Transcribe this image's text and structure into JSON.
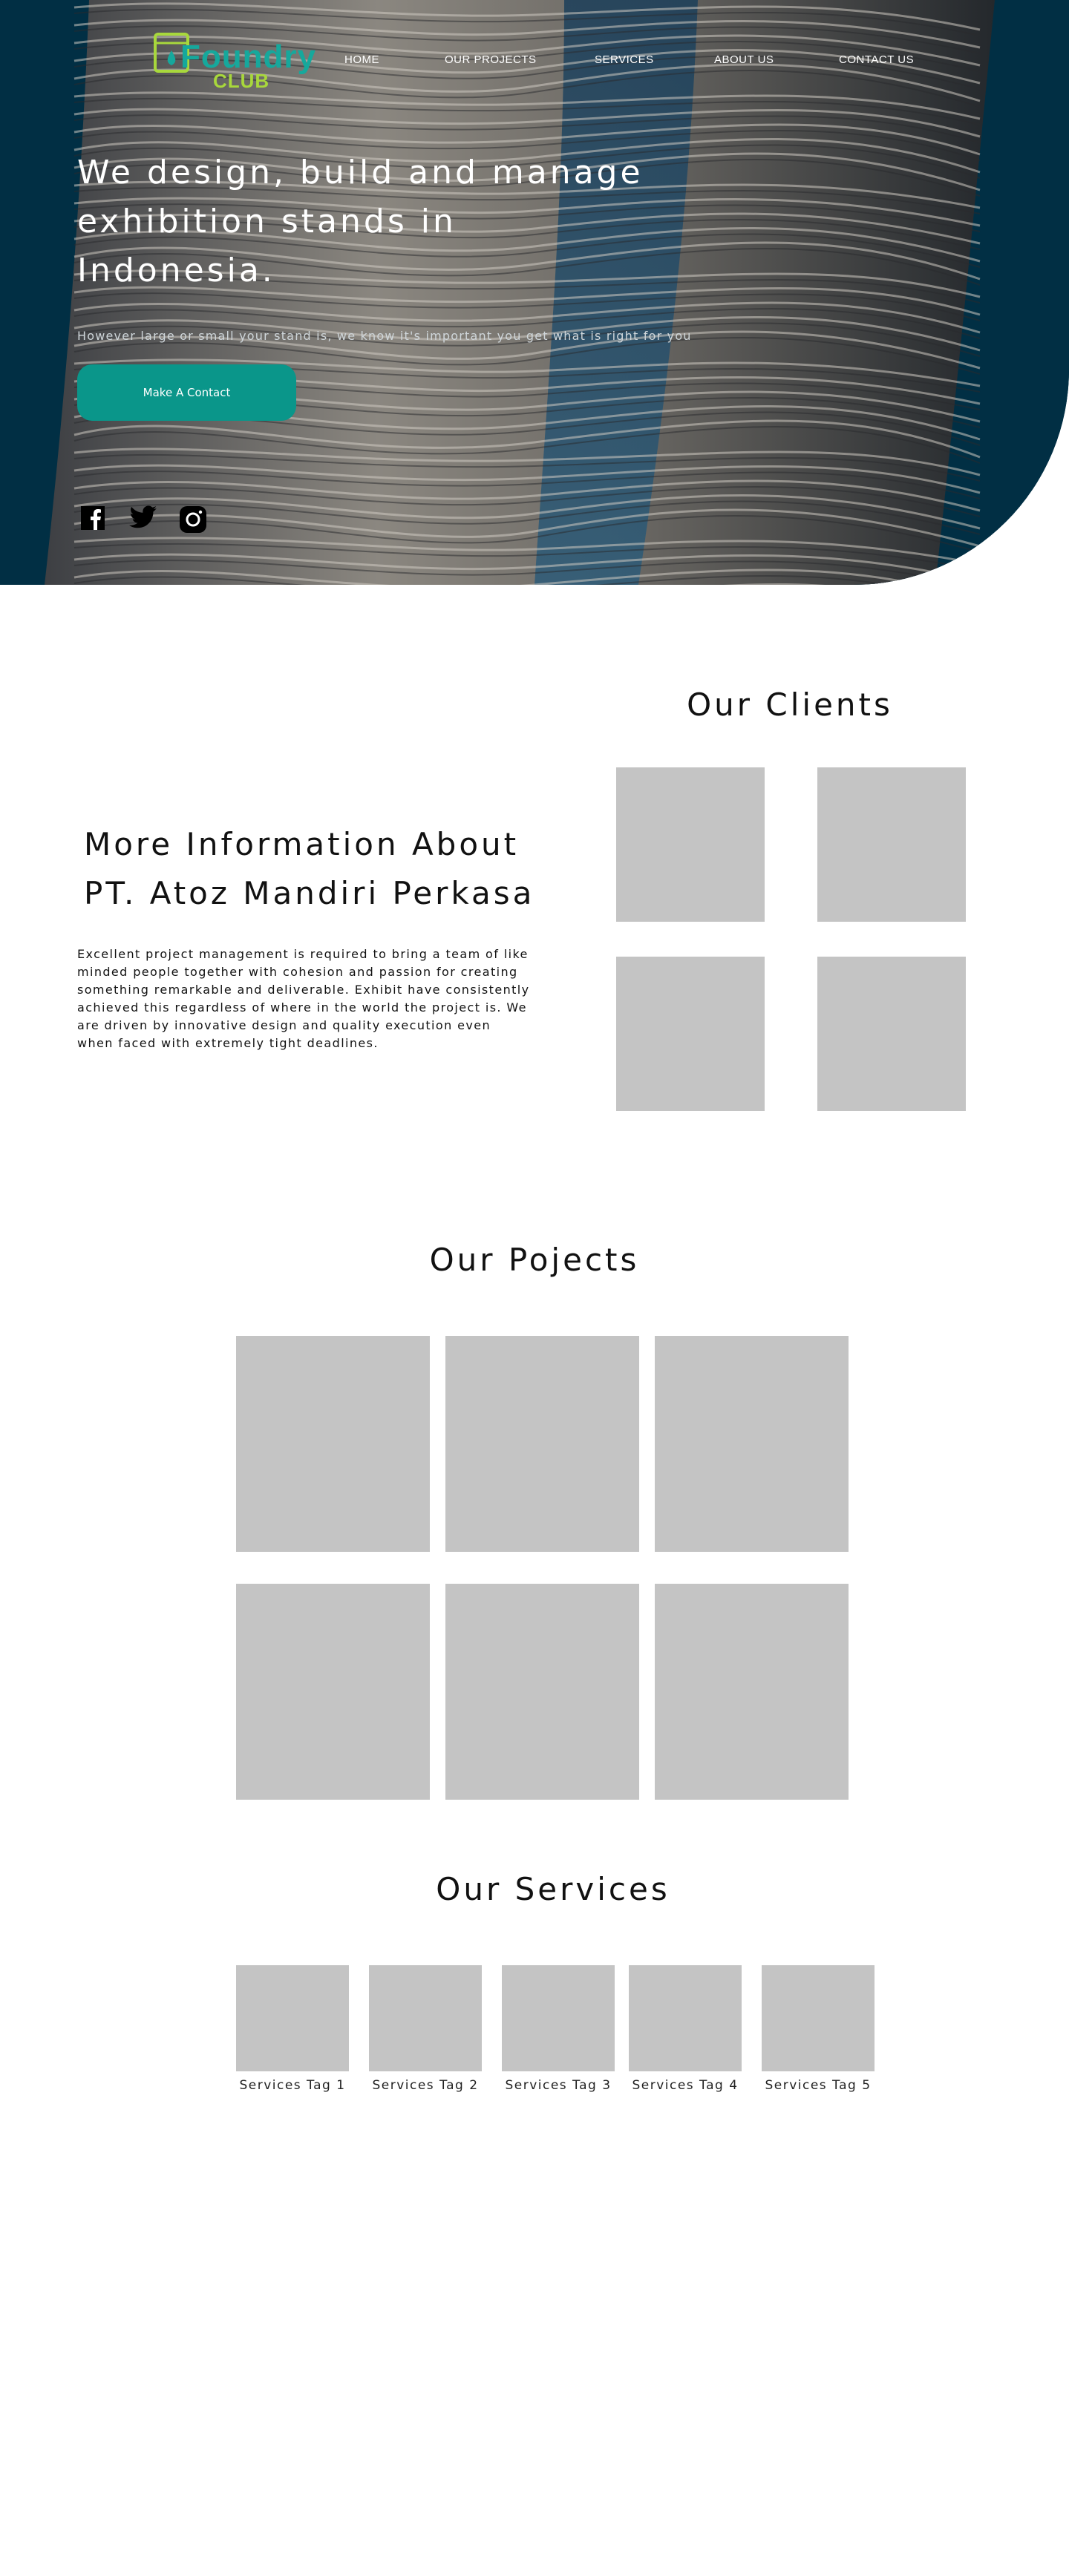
{
  "brand": {
    "logo_word": "Foundry",
    "logo_club": "CLUB"
  },
  "nav": {
    "items": [
      "HOME",
      "OUR PROJECTS",
      "SERVICES",
      "ABOUT US",
      "CONTACT US"
    ]
  },
  "hero": {
    "headline_line1": "We design, build and manage",
    "headline_line2": "exhibition stands in Indonesia.",
    "subtext": "However large or small your stand is, we know it's important you get what is right for you",
    "cta_label": "Make A Contact",
    "background_color": "#012f44",
    "cta_color": "#0a968a"
  },
  "social": {
    "icons": [
      "facebook-icon",
      "twitter-icon",
      "instagram-icon"
    ]
  },
  "about": {
    "heading_line1": "More Information About",
    "heading_line2": "PT. Atoz Mandiri Perkasa",
    "text": "Excellent project management is required to bring a team of like minded people together with cohesion and passion for creating something remarkable and deliverable. Exhibit have consistently achieved this regardless of where in the world the project is. We are driven by innovative design and quality execution even when faced with extremely tight deadlines."
  },
  "clients": {
    "title": "Our Clients"
  },
  "projects": {
    "title": "Our Pojects"
  },
  "services": {
    "title": "Our Services",
    "tags": [
      "Services Tag 1",
      "Services Tag 2",
      "Services Tag 3",
      "Services Tag 4",
      "Services Tag 5"
    ]
  },
  "colors": {
    "placeholder": "#c4c4c4",
    "accent": "#0a968a",
    "logo_lime": "#a8d83c"
  }
}
